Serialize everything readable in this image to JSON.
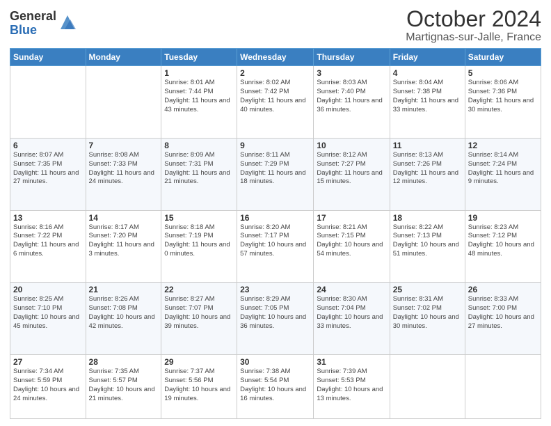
{
  "header": {
    "logo_general": "General",
    "logo_blue": "Blue",
    "title": "October 2024",
    "subtitle": "Martignas-sur-Jalle, France"
  },
  "days_of_week": [
    "Sunday",
    "Monday",
    "Tuesday",
    "Wednesday",
    "Thursday",
    "Friday",
    "Saturday"
  ],
  "weeks": [
    [
      {
        "day": "",
        "info": ""
      },
      {
        "day": "",
        "info": ""
      },
      {
        "day": "1",
        "info": "Sunrise: 8:01 AM\nSunset: 7:44 PM\nDaylight: 11 hours and 43 minutes."
      },
      {
        "day": "2",
        "info": "Sunrise: 8:02 AM\nSunset: 7:42 PM\nDaylight: 11 hours and 40 minutes."
      },
      {
        "day": "3",
        "info": "Sunrise: 8:03 AM\nSunset: 7:40 PM\nDaylight: 11 hours and 36 minutes."
      },
      {
        "day": "4",
        "info": "Sunrise: 8:04 AM\nSunset: 7:38 PM\nDaylight: 11 hours and 33 minutes."
      },
      {
        "day": "5",
        "info": "Sunrise: 8:06 AM\nSunset: 7:36 PM\nDaylight: 11 hours and 30 minutes."
      }
    ],
    [
      {
        "day": "6",
        "info": "Sunrise: 8:07 AM\nSunset: 7:35 PM\nDaylight: 11 hours and 27 minutes."
      },
      {
        "day": "7",
        "info": "Sunrise: 8:08 AM\nSunset: 7:33 PM\nDaylight: 11 hours and 24 minutes."
      },
      {
        "day": "8",
        "info": "Sunrise: 8:09 AM\nSunset: 7:31 PM\nDaylight: 11 hours and 21 minutes."
      },
      {
        "day": "9",
        "info": "Sunrise: 8:11 AM\nSunset: 7:29 PM\nDaylight: 11 hours and 18 minutes."
      },
      {
        "day": "10",
        "info": "Sunrise: 8:12 AM\nSunset: 7:27 PM\nDaylight: 11 hours and 15 minutes."
      },
      {
        "day": "11",
        "info": "Sunrise: 8:13 AM\nSunset: 7:26 PM\nDaylight: 11 hours and 12 minutes."
      },
      {
        "day": "12",
        "info": "Sunrise: 8:14 AM\nSunset: 7:24 PM\nDaylight: 11 hours and 9 minutes."
      }
    ],
    [
      {
        "day": "13",
        "info": "Sunrise: 8:16 AM\nSunset: 7:22 PM\nDaylight: 11 hours and 6 minutes."
      },
      {
        "day": "14",
        "info": "Sunrise: 8:17 AM\nSunset: 7:20 PM\nDaylight: 11 hours and 3 minutes."
      },
      {
        "day": "15",
        "info": "Sunrise: 8:18 AM\nSunset: 7:19 PM\nDaylight: 11 hours and 0 minutes."
      },
      {
        "day": "16",
        "info": "Sunrise: 8:20 AM\nSunset: 7:17 PM\nDaylight: 10 hours and 57 minutes."
      },
      {
        "day": "17",
        "info": "Sunrise: 8:21 AM\nSunset: 7:15 PM\nDaylight: 10 hours and 54 minutes."
      },
      {
        "day": "18",
        "info": "Sunrise: 8:22 AM\nSunset: 7:13 PM\nDaylight: 10 hours and 51 minutes."
      },
      {
        "day": "19",
        "info": "Sunrise: 8:23 AM\nSunset: 7:12 PM\nDaylight: 10 hours and 48 minutes."
      }
    ],
    [
      {
        "day": "20",
        "info": "Sunrise: 8:25 AM\nSunset: 7:10 PM\nDaylight: 10 hours and 45 minutes."
      },
      {
        "day": "21",
        "info": "Sunrise: 8:26 AM\nSunset: 7:08 PM\nDaylight: 10 hours and 42 minutes."
      },
      {
        "day": "22",
        "info": "Sunrise: 8:27 AM\nSunset: 7:07 PM\nDaylight: 10 hours and 39 minutes."
      },
      {
        "day": "23",
        "info": "Sunrise: 8:29 AM\nSunset: 7:05 PM\nDaylight: 10 hours and 36 minutes."
      },
      {
        "day": "24",
        "info": "Sunrise: 8:30 AM\nSunset: 7:04 PM\nDaylight: 10 hours and 33 minutes."
      },
      {
        "day": "25",
        "info": "Sunrise: 8:31 AM\nSunset: 7:02 PM\nDaylight: 10 hours and 30 minutes."
      },
      {
        "day": "26",
        "info": "Sunrise: 8:33 AM\nSunset: 7:00 PM\nDaylight: 10 hours and 27 minutes."
      }
    ],
    [
      {
        "day": "27",
        "info": "Sunrise: 7:34 AM\nSunset: 5:59 PM\nDaylight: 10 hours and 24 minutes."
      },
      {
        "day": "28",
        "info": "Sunrise: 7:35 AM\nSunset: 5:57 PM\nDaylight: 10 hours and 21 minutes."
      },
      {
        "day": "29",
        "info": "Sunrise: 7:37 AM\nSunset: 5:56 PM\nDaylight: 10 hours and 19 minutes."
      },
      {
        "day": "30",
        "info": "Sunrise: 7:38 AM\nSunset: 5:54 PM\nDaylight: 10 hours and 16 minutes."
      },
      {
        "day": "31",
        "info": "Sunrise: 7:39 AM\nSunset: 5:53 PM\nDaylight: 10 hours and 13 minutes."
      },
      {
        "day": "",
        "info": ""
      },
      {
        "day": "",
        "info": ""
      }
    ]
  ]
}
